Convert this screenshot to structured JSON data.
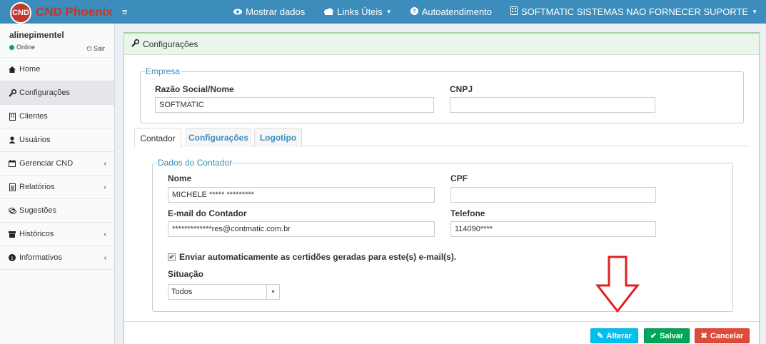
{
  "app": {
    "logo_badge": "CND",
    "logo_text": "CND Phoenix"
  },
  "topbar": {
    "menu_icon": "hamburger-icon",
    "mostrar_dados": "Mostrar dados",
    "links_uteis": "Links Úteis",
    "autoatendimento": "Autoatendimento",
    "company": "SOFTMATIC SISTEMAS NAO FORNECER SUPORTE"
  },
  "user": {
    "name": "alinepimentel",
    "status": "Online",
    "logout": "Sair"
  },
  "sidebar": {
    "items": [
      {
        "label": "Home",
        "icon": "home-icon"
      },
      {
        "label": "Configurações",
        "icon": "wrench-icon",
        "active": true
      },
      {
        "label": "Clientes",
        "icon": "building-icon"
      },
      {
        "label": "Usuários",
        "icon": "user-icon"
      },
      {
        "label": "Gerenciar CND",
        "icon": "calendar-icon",
        "chevron": "‹"
      },
      {
        "label": "Relatórios",
        "icon": "report-icon",
        "chevron": "‹"
      },
      {
        "label": "Sugestões",
        "icon": "comments-icon"
      },
      {
        "label": "Históricos",
        "icon": "history-icon",
        "chevron": "‹"
      },
      {
        "label": "Informativos",
        "icon": "info-icon",
        "chevron": "‹"
      }
    ]
  },
  "box": {
    "title": "Configurações"
  },
  "empresa": {
    "legend": "Empresa",
    "razao_label": "Razão Social/Nome",
    "razao_value": "SOFTMATIC",
    "cnpj_label": "CNPJ",
    "cnpj_value": ""
  },
  "tabs": [
    "Contador",
    "Configurações",
    "Logotipo"
  ],
  "contador": {
    "legend": "Dados do Contador",
    "nome_label": "Nome",
    "nome_value": "MICHELE  ***** *********",
    "cpf_label": "CPF",
    "cpf_value": "",
    "email_label": "E-mail do Contador",
    "email_value": "*************res@contmatic.com.br",
    "telefone_label": "Telefone",
    "telefone_value": "114090****",
    "checkbox_label": "Enviar automaticamente as certidões geradas para este(s) e-mail(s).",
    "checkbox_checked": true,
    "situacao_label": "Situação",
    "situacao_value": "Todos"
  },
  "buttons": {
    "alterar": "Alterar",
    "salvar": "Salvar",
    "cancelar": "Cancelar"
  },
  "colors": {
    "header": "#3c8dbc",
    "alterar": "#00c0ef",
    "salvar": "#00a65a",
    "cancelar": "#dd4b39",
    "arrow": "#e02020"
  }
}
